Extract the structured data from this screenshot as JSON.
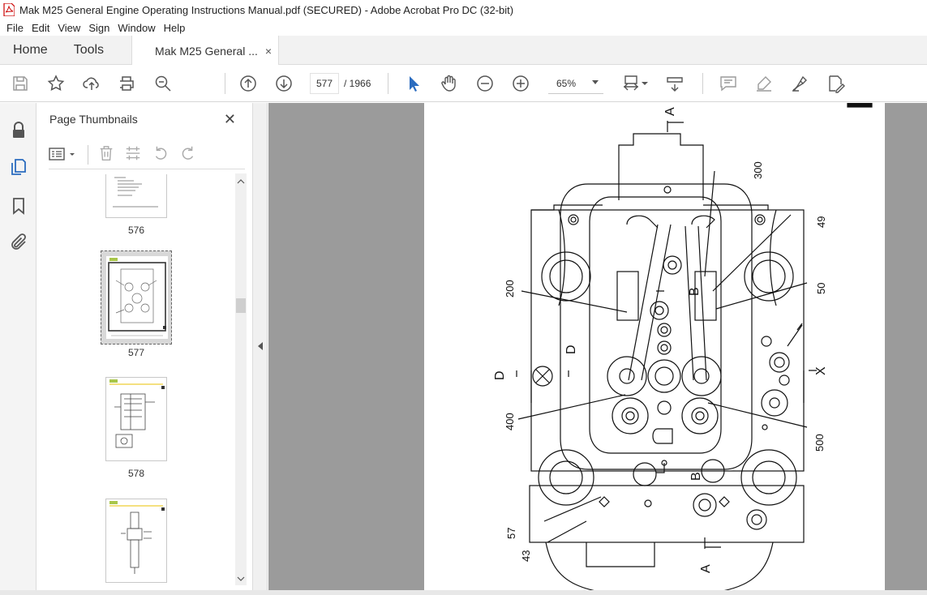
{
  "window": {
    "title": "Mak M25 General Engine Operating Instructions Manual.pdf (SECURED) - Adobe Acrobat Pro DC (32-bit)"
  },
  "menu": [
    "File",
    "Edit",
    "View",
    "Sign",
    "Window",
    "Help"
  ],
  "tabs": {
    "home": "Home",
    "tools": "Tools",
    "doc": "Mak M25 General ...",
    "close": "×"
  },
  "toolbar": {
    "page_current": "577",
    "page_total": "/  1966",
    "zoom": "65%",
    "icons": [
      "save-icon",
      "bookmark-star-icon",
      "upload-icon",
      "print-icon",
      "search-zoom-icon",
      "prev-page-icon",
      "next-page-icon",
      "select-pointer-icon",
      "hand-icon",
      "zoom-out-icon",
      "zoom-in-icon",
      "fit-page-icon",
      "scroll-mode-icon",
      "comment-icon",
      "highlight-icon",
      "sign-icon",
      "edit-pdf-icon"
    ]
  },
  "panel": {
    "title": "Page Thumbnails",
    "close": "✕",
    "thumbnails": [
      {
        "label": "576"
      },
      {
        "label": "577",
        "selected": true
      },
      {
        "label": "578"
      },
      {
        "label": ""
      }
    ]
  },
  "drawing": {
    "labels": {
      "a_top": "A",
      "a_bottom": "A",
      "b_mid": "B",
      "b_bottom": "B",
      "d_left": "D",
      "d_mid": "D",
      "x_right": "X",
      "n300": "300",
      "n49": "49",
      "n50": "50",
      "n200": "200",
      "n400": "400",
      "n500": "500",
      "n57": "57",
      "n43": "43"
    }
  },
  "colors": {
    "accent": "#2b6cbf",
    "chrome": "#f2f2f2",
    "doc_bg": "#9b9b9b"
  }
}
